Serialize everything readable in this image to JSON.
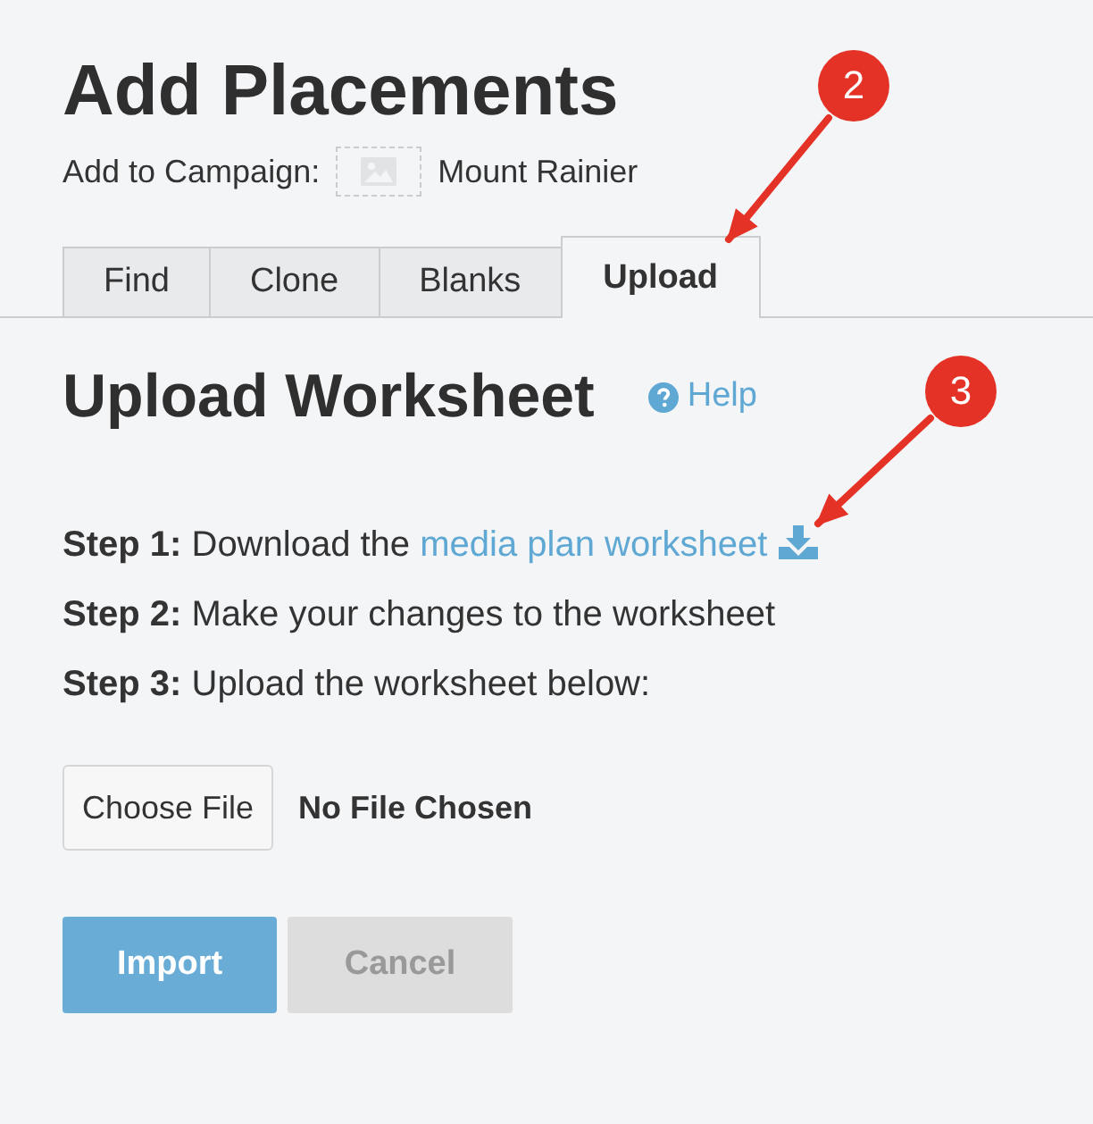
{
  "title": "Add Placements",
  "campaign": {
    "label": "Add to Campaign:",
    "name": "Mount Rainier"
  },
  "tabs": [
    {
      "label": "Find",
      "selected": false
    },
    {
      "label": "Clone",
      "selected": false
    },
    {
      "label": "Blanks",
      "selected": false
    },
    {
      "label": "Upload",
      "selected": true
    }
  ],
  "heading": "Upload Worksheet",
  "help": "Help",
  "steps": [
    {
      "text": "**Step 1:** Download the ",
      "link": "media plan worksheet"
    },
    {
      "text": "**Step 2:** Make your changes to the worksheet"
    },
    {
      "text": "**Step 3:** Upload the worksheet below:"
    }
  ],
  "file": {
    "button": "Choose File",
    "status": "No File Chosen"
  },
  "buttons": [
    {
      "label": "Import",
      "kind": "primary",
      "disabled": false
    },
    {
      "label": "Cancel",
      "kind": "secondary",
      "disabled": true
    }
  ],
  "callouts": [
    {
      "number": "2"
    },
    {
      "number": "3"
    }
  ]
}
